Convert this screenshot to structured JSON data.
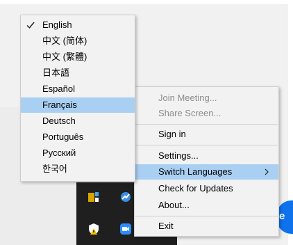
{
  "background": {
    "blue_button_letter": "e"
  },
  "language_menu": {
    "items": [
      {
        "label": "English",
        "checked": true
      },
      {
        "label": "中文 (简体)"
      },
      {
        "label": "中文 (繁體)"
      },
      {
        "label": "日本語"
      },
      {
        "label": "Español"
      },
      {
        "label": "Français",
        "highlighted": true
      },
      {
        "label": "Deutsch"
      },
      {
        "label": "Português"
      },
      {
        "label": "Русский"
      },
      {
        "label": "한국어"
      }
    ]
  },
  "context_menu": {
    "join_meeting": "Join Meeting...",
    "share_screen": "Share Screen...",
    "sign_in": "Sign in",
    "settings": "Settings...",
    "switch_languages": "Switch Languages",
    "check_updates": "Check for Updates",
    "about": "About...",
    "exit": "Exit"
  },
  "colors": {
    "highlight": "#a9cff2",
    "menu_bg": "#f2f2f2",
    "disabled_text": "#8c8c8c",
    "zoom_blue": "#0e72ed",
    "tray_bg": "#1f1f1f"
  }
}
